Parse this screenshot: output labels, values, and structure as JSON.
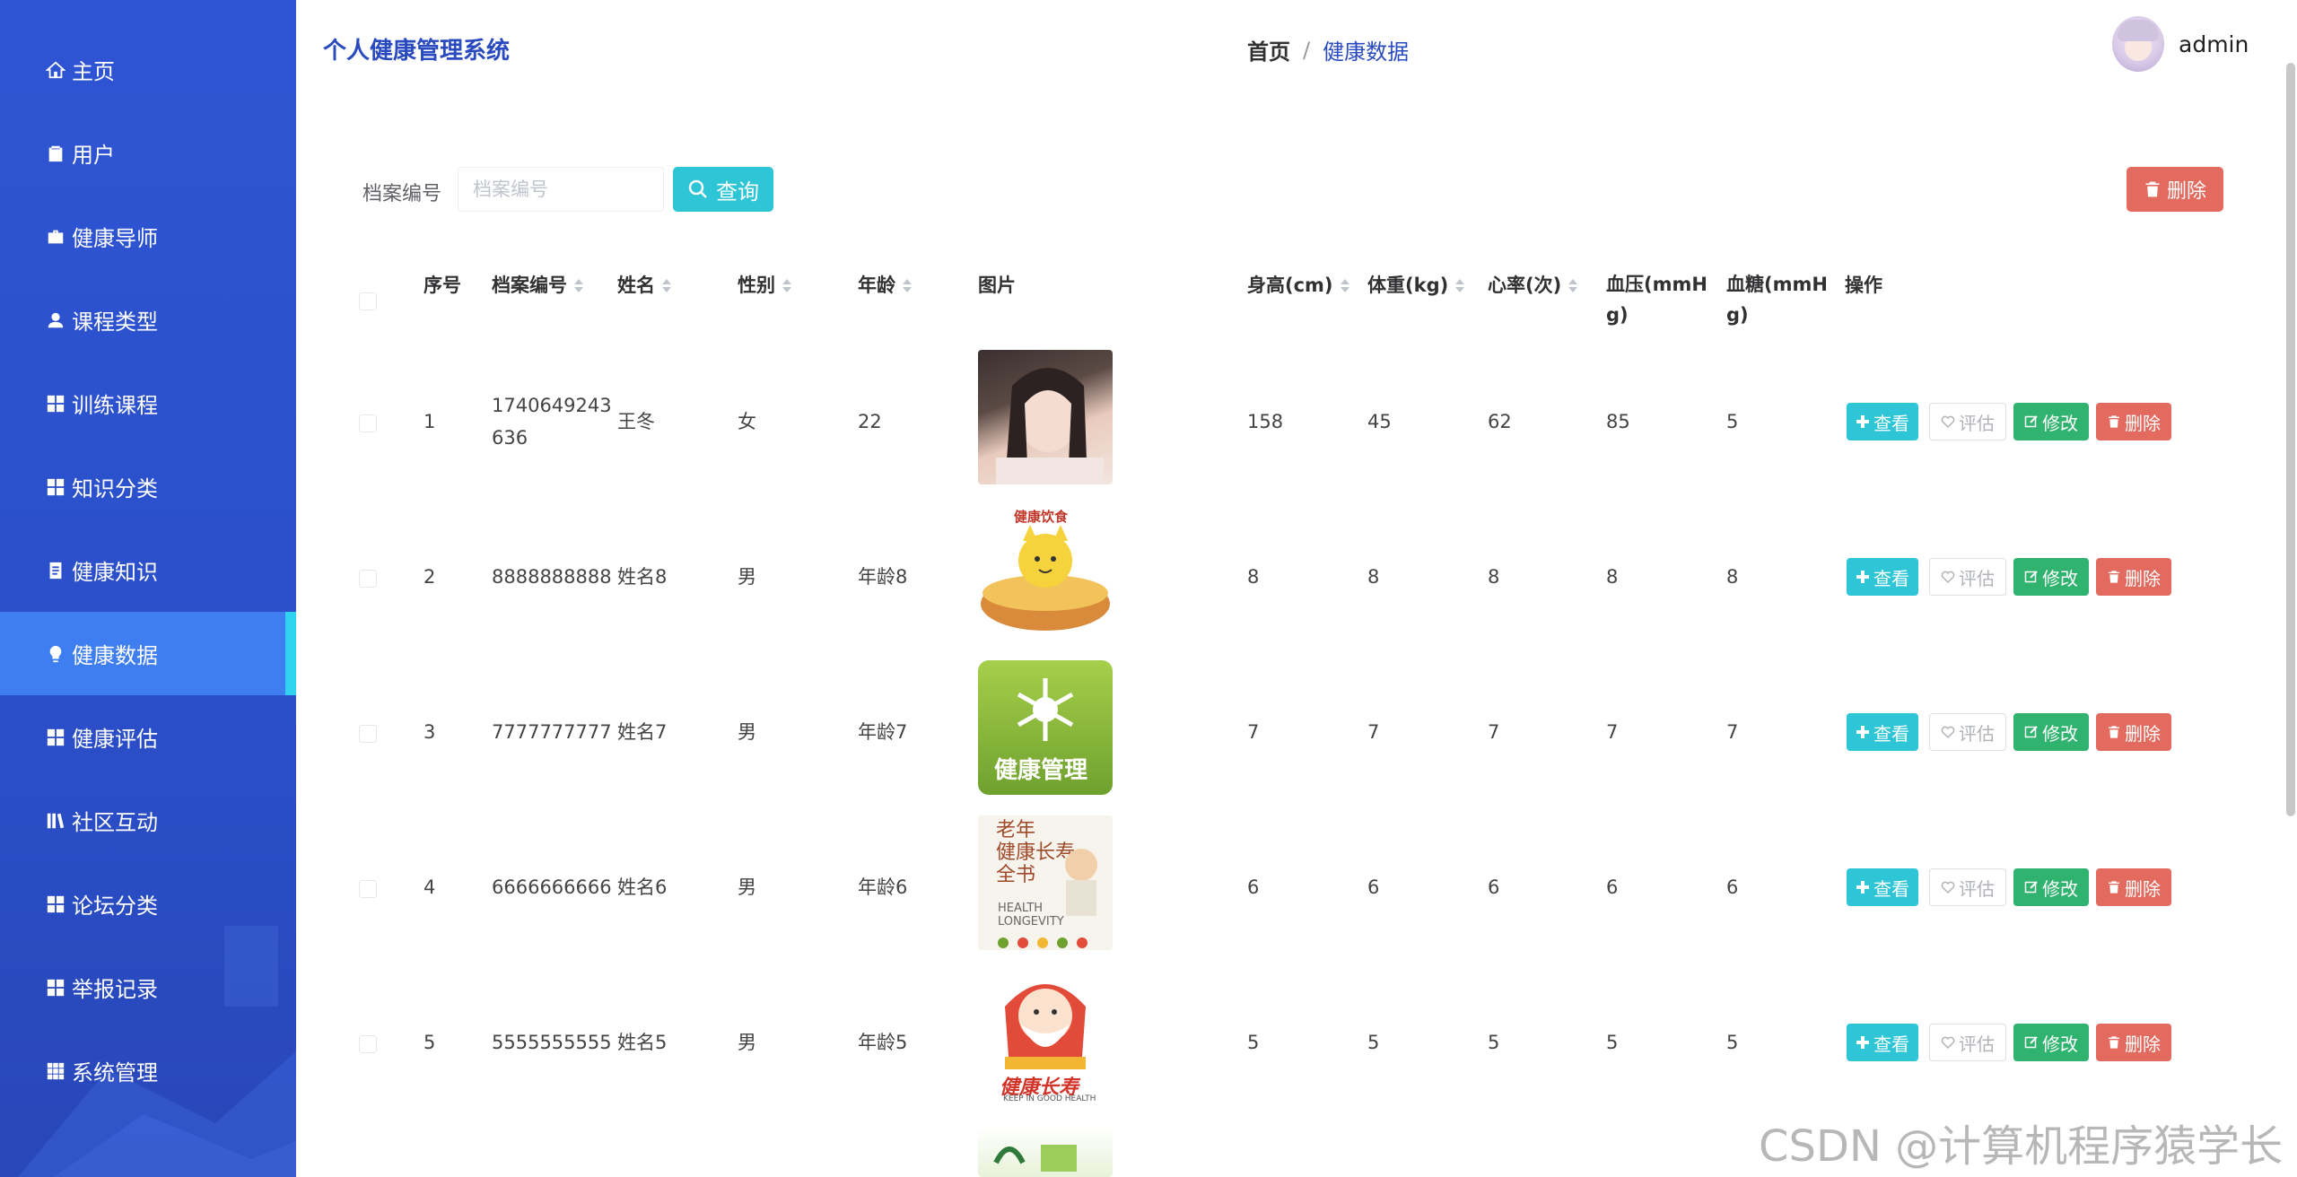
{
  "app": {
    "title": "个人健康管理系统"
  },
  "sidebar": {
    "items": [
      {
        "label": "主页",
        "icon": "home-icon"
      },
      {
        "label": "用户",
        "icon": "clipboard-icon"
      },
      {
        "label": "健康导师",
        "icon": "briefcase-icon"
      },
      {
        "label": "课程类型",
        "icon": "user-icon"
      },
      {
        "label": "训练课程",
        "icon": "grid-icon"
      },
      {
        "label": "知识分类",
        "icon": "grid-icon"
      },
      {
        "label": "健康知识",
        "icon": "document-icon"
      },
      {
        "label": "健康数据",
        "icon": "bulb-icon",
        "active": true
      },
      {
        "label": "健康评估",
        "icon": "grid-icon"
      },
      {
        "label": "社区互动",
        "icon": "books-icon"
      },
      {
        "label": "论坛分类",
        "icon": "grid-icon"
      },
      {
        "label": "举报记录",
        "icon": "grid-icon"
      },
      {
        "label": "系统管理",
        "icon": "grid-icon"
      }
    ]
  },
  "header": {
    "breadcrumb_home": "首页",
    "breadcrumb_sep": "/",
    "breadcrumb_current": "健康数据",
    "username": "admin"
  },
  "search": {
    "label": "档案编号",
    "placeholder": "档案编号",
    "value": "",
    "query_button": "查询",
    "delete_button": "删除"
  },
  "table": {
    "columns": [
      "序号",
      "档案编号",
      "姓名",
      "性别",
      "年龄",
      "图片",
      "身高(cm)",
      "体重(kg)",
      "心率(次)",
      "血压(mmH g)",
      "血糖(mmH g)",
      "操作"
    ],
    "col_bp_l1": "血压(mmH",
    "col_bp_l2": "g)",
    "col_bs_l1": "血糖(mmH",
    "col_bs_l2": "g)",
    "actions": {
      "view": "查看",
      "eval": "评估",
      "edit": "修改",
      "delete": "删除"
    },
    "rows": [
      {
        "no": "1",
        "id_l1": "1740649243",
        "id_l2": "636",
        "name": "王冬",
        "gender": "女",
        "age": "22",
        "height": "158",
        "weight": "45",
        "heart": "62",
        "bp": "85",
        "bs": "5",
        "img": "portrait"
      },
      {
        "no": "2",
        "id_l1": "8888888888",
        "id_l2": "",
        "name": "姓名8",
        "gender": "男",
        "age": "年龄8",
        "height": "8",
        "weight": "8",
        "heart": "8",
        "bp": "8",
        "bs": "8",
        "img": "food",
        "img_caption": "健康饮食"
      },
      {
        "no": "3",
        "id_l1": "7777777777",
        "id_l2": "",
        "name": "姓名7",
        "gender": "男",
        "age": "年龄7",
        "height": "7",
        "weight": "7",
        "heart": "7",
        "bp": "7",
        "bs": "7",
        "img": "manage",
        "img_caption": "健康管理"
      },
      {
        "no": "4",
        "id_l1": "6666666666",
        "id_l2": "",
        "name": "姓名6",
        "gender": "男",
        "age": "年龄6",
        "height": "6",
        "weight": "6",
        "heart": "6",
        "bp": "6",
        "bs": "6",
        "img": "book",
        "img_caption_l1": "老年",
        "img_caption_l2": "健康长寿",
        "img_caption_l3": "全书",
        "img_caption_en1": "HEALTH",
        "img_caption_en2": "LONGEVITY"
      },
      {
        "no": "5",
        "id_l1": "5555555555",
        "id_l2": "",
        "name": "姓名5",
        "gender": "男",
        "age": "年龄5",
        "height": "5",
        "weight": "5",
        "heart": "5",
        "bp": "5",
        "bs": "5",
        "img": "elder",
        "img_caption": "健康长寿",
        "img_caption_en": "KEEP IN GOOD HEALTH"
      }
    ]
  },
  "watermark": "CSDN @计算机程序猿学长",
  "colors": {
    "sidebar": "#2f55d4",
    "active": "#3e7ef0",
    "accent": "#2ec5d6",
    "edit": "#2fb36e",
    "danger": "#e36a5e"
  }
}
